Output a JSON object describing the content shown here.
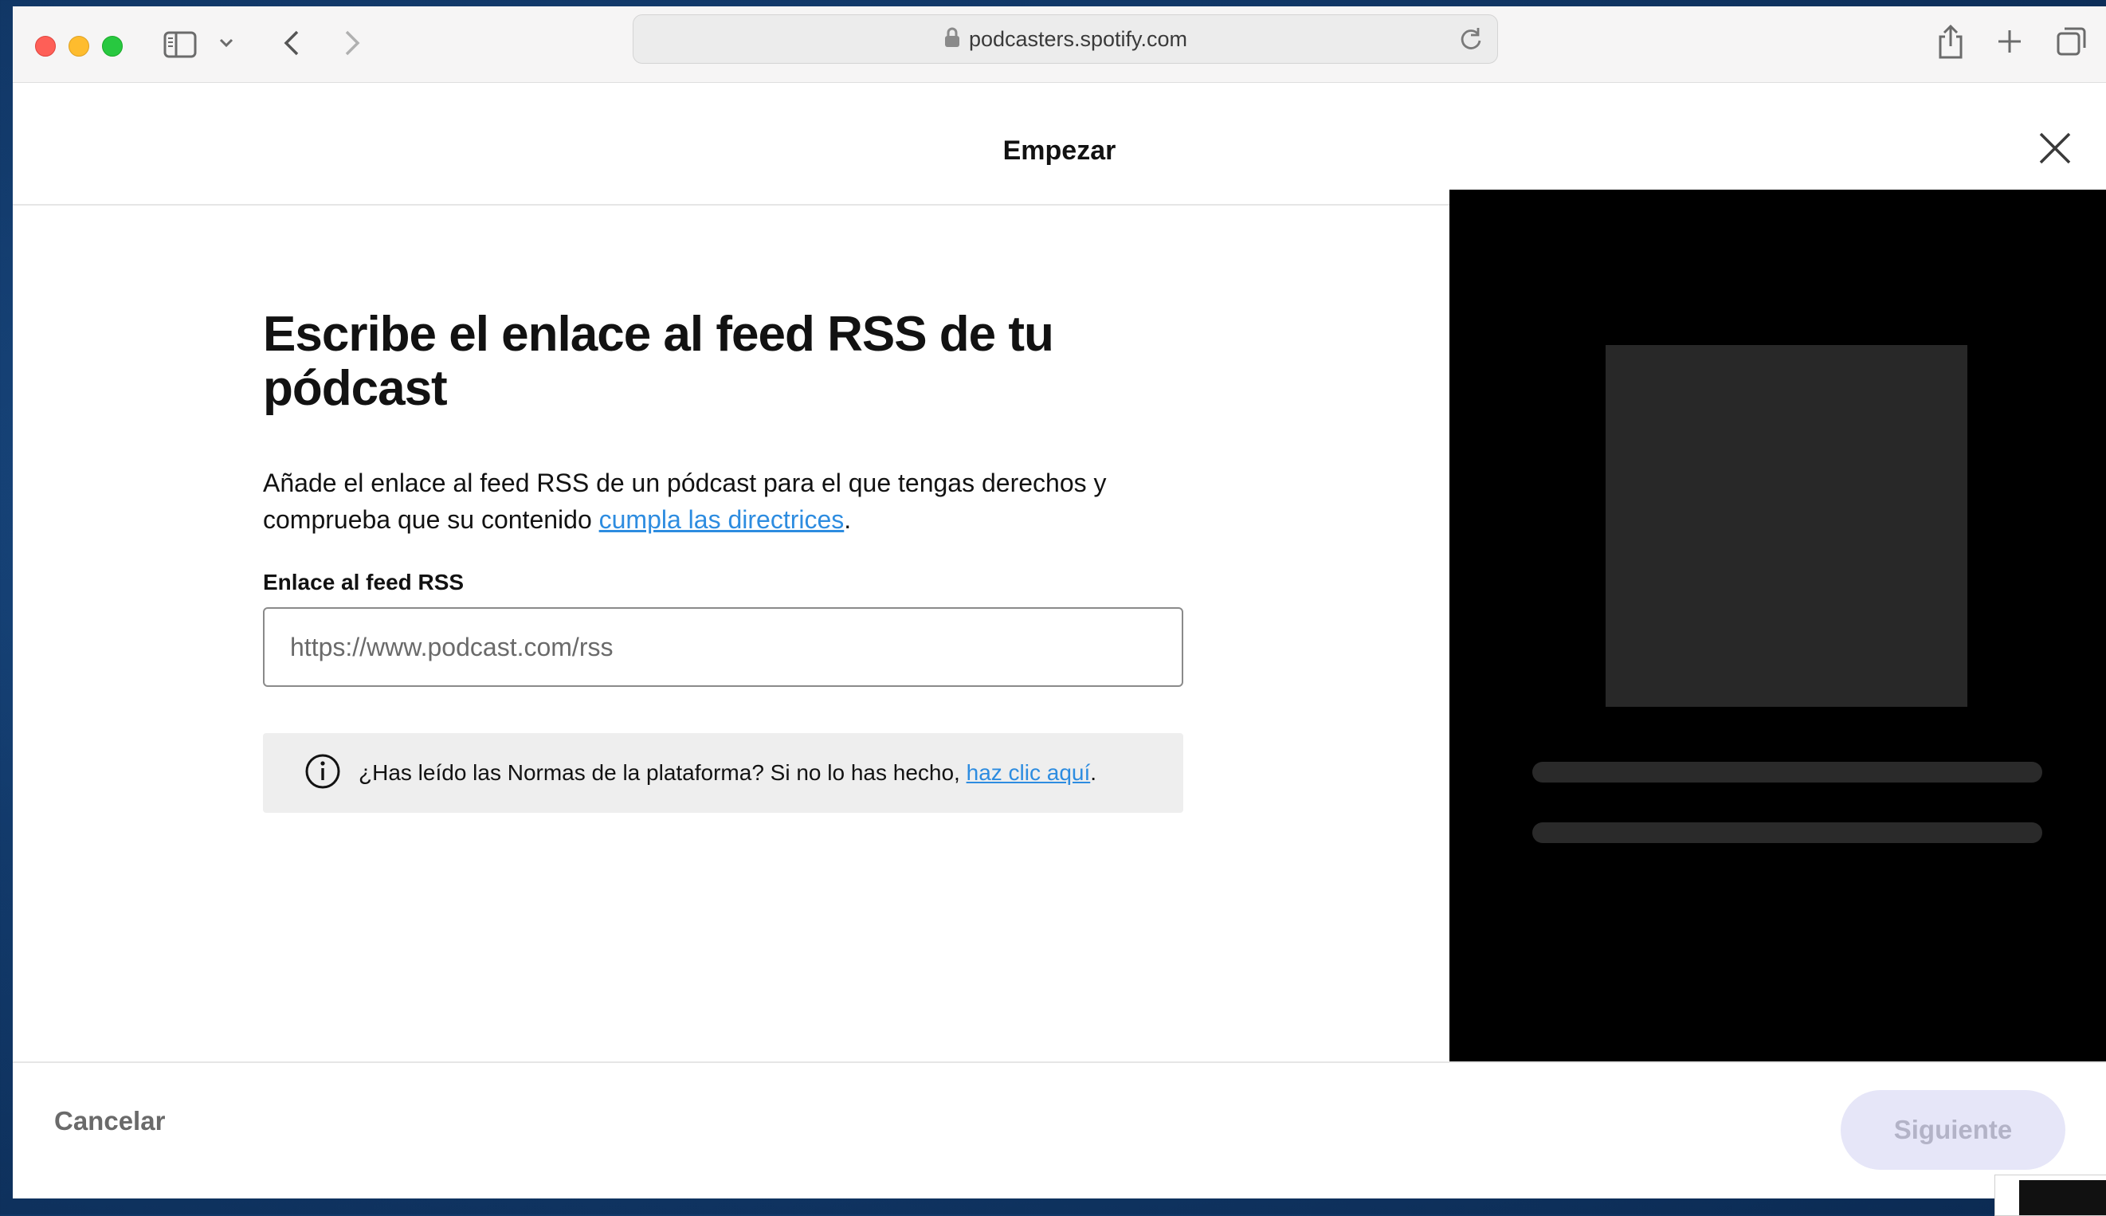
{
  "browser": {
    "url": "podcasters.spotify.com"
  },
  "header": {
    "title": "Empezar"
  },
  "main": {
    "heading": "Escribe el enlace al feed RSS de tu pódcast",
    "description_before": "Añade el enlace al feed RSS de un pódcast para el que tengas derechos y comprueba que su contenido ",
    "description_link": "cumpla las directrices",
    "description_after": ".",
    "field_label": "Enlace al feed RSS",
    "field_placeholder": "https://www.podcast.com/rss",
    "field_value": "",
    "notice_text": "¿Has leído las Normas de la plataforma? Si no lo has hecho, ",
    "notice_link": "haz clic aquí",
    "notice_after": "."
  },
  "footer": {
    "cancel_label": "Cancelar",
    "next_label": "Siguiente"
  },
  "colors": {
    "link": "#2d8ce0",
    "preview_bg": "#000000",
    "next_disabled_bg": "#e6e6f8"
  },
  "icons": [
    "sidebar-icon",
    "chevron-down-icon",
    "back-icon",
    "forward-icon",
    "lock-icon",
    "reload-icon",
    "share-icon",
    "plus-icon",
    "tabs-icon",
    "close-icon",
    "info-icon"
  ]
}
